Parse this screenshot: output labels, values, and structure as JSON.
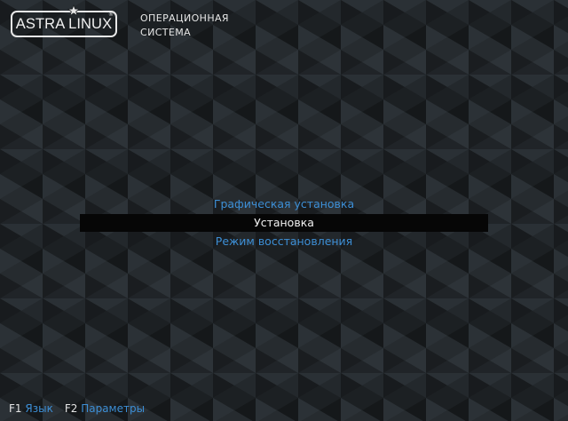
{
  "header": {
    "logo_text": "ASTRA LINUX",
    "logo_mark": "®",
    "caption_line1": "ОПЕРАЦИОННАЯ",
    "caption_line2": "СИСТЕМА"
  },
  "menu": {
    "items": [
      {
        "label": "Графическая установка",
        "selected": false
      },
      {
        "label": "Установка",
        "selected": true
      },
      {
        "label": "Режим восстановления",
        "selected": false
      }
    ]
  },
  "footer": {
    "keys": [
      {
        "key": "F1",
        "label": "Язык"
      },
      {
        "key": "F2",
        "label": "Параметры"
      }
    ]
  },
  "colors": {
    "background": "#1f2326",
    "menu_text": "#3d8fd6",
    "selected_bar": "#060606",
    "selected_text": "#f2f2f2"
  },
  "icons": {
    "logo_star": "star-icon"
  }
}
